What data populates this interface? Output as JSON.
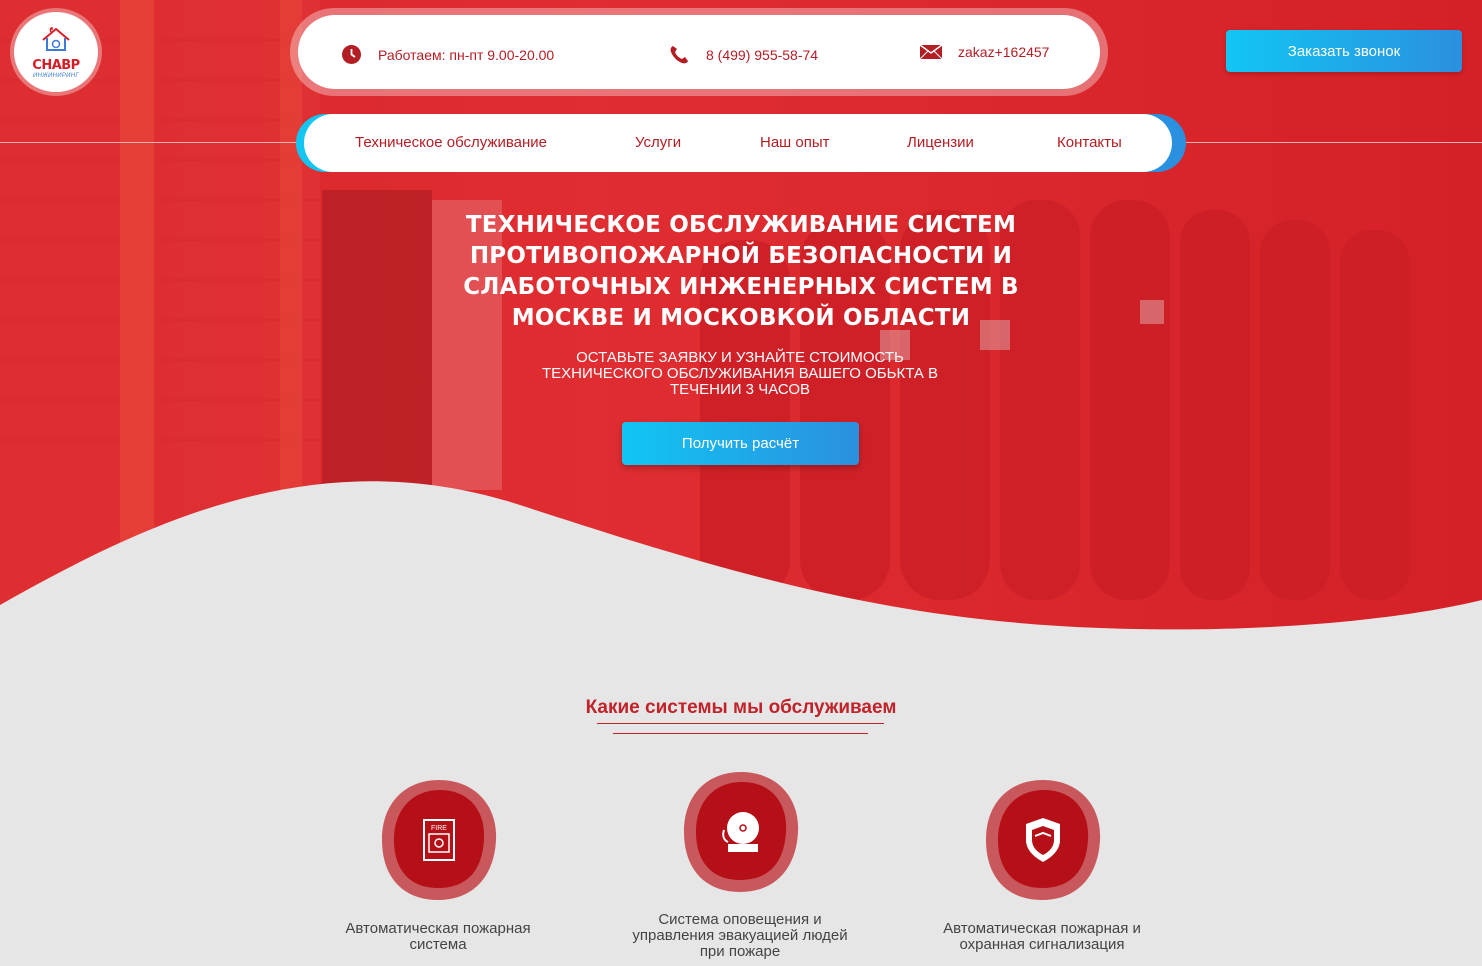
{
  "logo": {
    "word": "СНАВР",
    "sub": "ИНЖИНИРИНГ"
  },
  "header": {
    "hours": "Работаем: пн-пт 9.00-20.00",
    "phone": "8 (499) 955-58-74",
    "email": "zakaz+162457",
    "call_button": "Заказать звонок"
  },
  "nav": {
    "items": [
      "Техническое обслуживание",
      "Услуги",
      "Наш опыт",
      "Лицензии",
      "Контакты"
    ]
  },
  "hero": {
    "title": "ТЕХНИЧЕСКОЕ ОБСЛУЖИВАНИЕ СИСТЕМ ПРОТИВОПОЖАРНОЙ БЕЗОПАСНОСТИ И СЛАБОТОЧНЫХ ИНЖЕНЕРНЫХ СИСТЕМ В МОСКВЕ И МОСКОВКОЙ ОБЛАСТИ",
    "subtitle": "ОСТАВЬТЕ ЗАЯВКУ И УЗНАЙТЕ СТОИМОСТЬ ТЕХНИЧЕСКОГО ОБСЛУЖИВАНИЯ ВАШЕГО ОБЬКТА В ТЕЧЕНИИ 3 ЧАСОВ",
    "button": "Получить расчёт"
  },
  "systems": {
    "title": "Какие системы мы обслуживаем",
    "items": [
      {
        "label": "Автоматическая пожарная система",
        "icon": "fire-alarm-icon"
      },
      {
        "label": "Система оповещения и управления эвакуацией людей при пожаре",
        "icon": "bell-icon"
      },
      {
        "label": "Автоматическая пожарная и охранная сигнализация",
        "icon": "shield-icon"
      }
    ]
  },
  "colors": {
    "brand_red": "#c0232a",
    "hero_red": "#dc2a2e",
    "button_blue_start": "#11c6f2",
    "button_blue_end": "#2b8fe0",
    "bg_gray": "#e6e6e6"
  }
}
